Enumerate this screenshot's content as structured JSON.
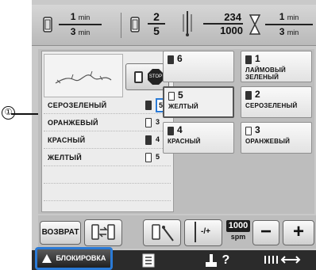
{
  "callout": {
    "number": "①"
  },
  "status": {
    "stitch_time": {
      "top": "1",
      "bottom": "3",
      "unit": "min"
    },
    "color_count": {
      "top": "2",
      "bottom": "5"
    },
    "stitch_count": {
      "top": "234",
      "bottom": "1000"
    },
    "total_time": {
      "top": "1",
      "bottom": "3",
      "unit": "min"
    }
  },
  "stop_button": {
    "label": "STOP"
  },
  "color_list": [
    {
      "name": "СЕРОЗЕЛЕНЫЙ",
      "number": "5",
      "selected": true,
      "spool": "dark"
    },
    {
      "name": "ОРАНЖЕВЫЙ",
      "number": "3",
      "selected": false,
      "spool": "light"
    },
    {
      "name": "КРАСНЫЙ",
      "number": "4",
      "selected": false,
      "spool": "dark"
    },
    {
      "name": "ЖЕЛТЫЙ",
      "number": "5",
      "selected": false,
      "spool": "light"
    }
  ],
  "color_cells": [
    {
      "number": "6",
      "label": ""
    },
    {
      "number": "1",
      "label": "ЛАЙМОВЫЙ\nЗЕЛЕНЫЙ"
    },
    {
      "number": "5",
      "label": "ЖЕЛТЫЙ"
    },
    {
      "number": "2",
      "label": "СЕРОЗЕЛЕНЫЙ"
    },
    {
      "number": "4",
      "label": "КРАСНЫЙ"
    },
    {
      "number": "3",
      "label": "ОРАНЖЕВЫЙ"
    }
  ],
  "buttons": {
    "return_label": "ВОЗВРАТ",
    "speed_value": "1000",
    "speed_unit": "spm",
    "minus": "−",
    "plus": "+",
    "stitch_jump": "-/+"
  },
  "tabs": {
    "lock_label": "БЛОКИРОВКА",
    "help_label": "?"
  },
  "colors": {
    "highlight": "#2a7ad6",
    "lcd_bg": "#c9c9c9",
    "tab_bg": "#2b2b2b"
  }
}
